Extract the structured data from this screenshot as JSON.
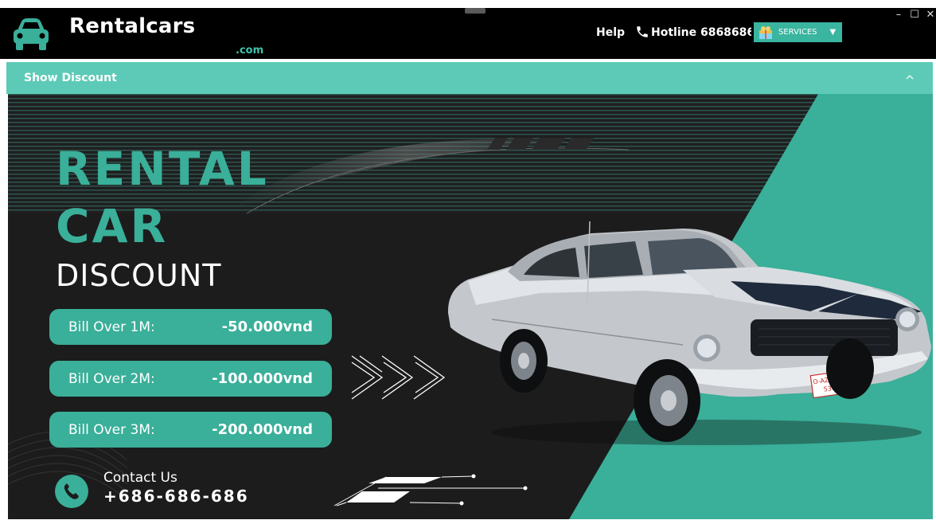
{
  "header": {
    "brand": "Rentalcars",
    "brand_suffix": ".com",
    "help_label": "Help",
    "hotline_label": "Hotline 68686868",
    "services_label": "SERVICES",
    "window_controls": [
      "–",
      "☐",
      "✕"
    ]
  },
  "discount_panel": {
    "title": "Show Discount"
  },
  "banner": {
    "title_line1": "RENTAL",
    "title_line2": "CAR",
    "subtitle": "DISCOUNT",
    "offers": [
      {
        "label": "Bill Over 1M:",
        "value": "-50.000vnd"
      },
      {
        "label": "Bill Over 2M:",
        "value": "-100.000vnd"
      },
      {
        "label": "Bill Over 3M:",
        "value": "-200.000vnd"
      }
    ],
    "contact_label": "Contact Us",
    "contact_number": "+686-686-686",
    "plate": "O-AZB 530"
  },
  "colors": {
    "teal": "#3aaf99",
    "header_teal": "#5ccab6",
    "dark": "#1c1c1c"
  },
  "icons": [
    "car-logo-icon",
    "phone-icon",
    "services-gift-icon",
    "dropdown-arrow-icon",
    "collapse-chevron-icon",
    "phone-circle-icon"
  ]
}
